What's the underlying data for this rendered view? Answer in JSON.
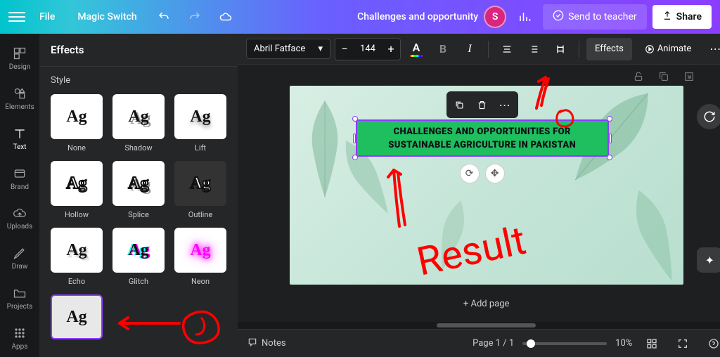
{
  "topbar": {
    "file_label": "File",
    "magic_label": "Magic Switch",
    "doc_title": "Challenges and opportunity",
    "avatar_initial": "S",
    "send_label": "Send to teacher",
    "share_label": "Share"
  },
  "rail": {
    "items": [
      {
        "label": "Design"
      },
      {
        "label": "Elements"
      },
      {
        "label": "Text"
      },
      {
        "label": "Brand"
      },
      {
        "label": "Uploads"
      },
      {
        "label": "Draw"
      },
      {
        "label": "Projects"
      },
      {
        "label": "Apps"
      }
    ]
  },
  "panel": {
    "title": "Effects",
    "section_label": "Style",
    "styles": [
      {
        "label": "None"
      },
      {
        "label": "Shadow"
      },
      {
        "label": "Lift"
      },
      {
        "label": "Hollow"
      },
      {
        "label": "Splice"
      },
      {
        "label": "Outline"
      },
      {
        "label": "Echo"
      },
      {
        "label": "Glitch"
      },
      {
        "label": "Neon"
      },
      {
        "label": ""
      }
    ],
    "thumb_text": "Ag"
  },
  "toolbar": {
    "font_name": "Abril Fatface",
    "font_size": "144",
    "effects_label": "Effects",
    "animate_label": "Animate"
  },
  "canvas": {
    "text_line1": "CHALLENGES AND OPPORTUNITIES FOR",
    "text_line2": "SUSTAINABLE AGRICULTURE IN PAKISTAN",
    "add_page_label": "+ Add page"
  },
  "bottombar": {
    "notes_label": "Notes",
    "page_indicator": "Page 1 / 1",
    "zoom_label": "10%"
  },
  "annotations": {
    "result_text": "Result"
  }
}
